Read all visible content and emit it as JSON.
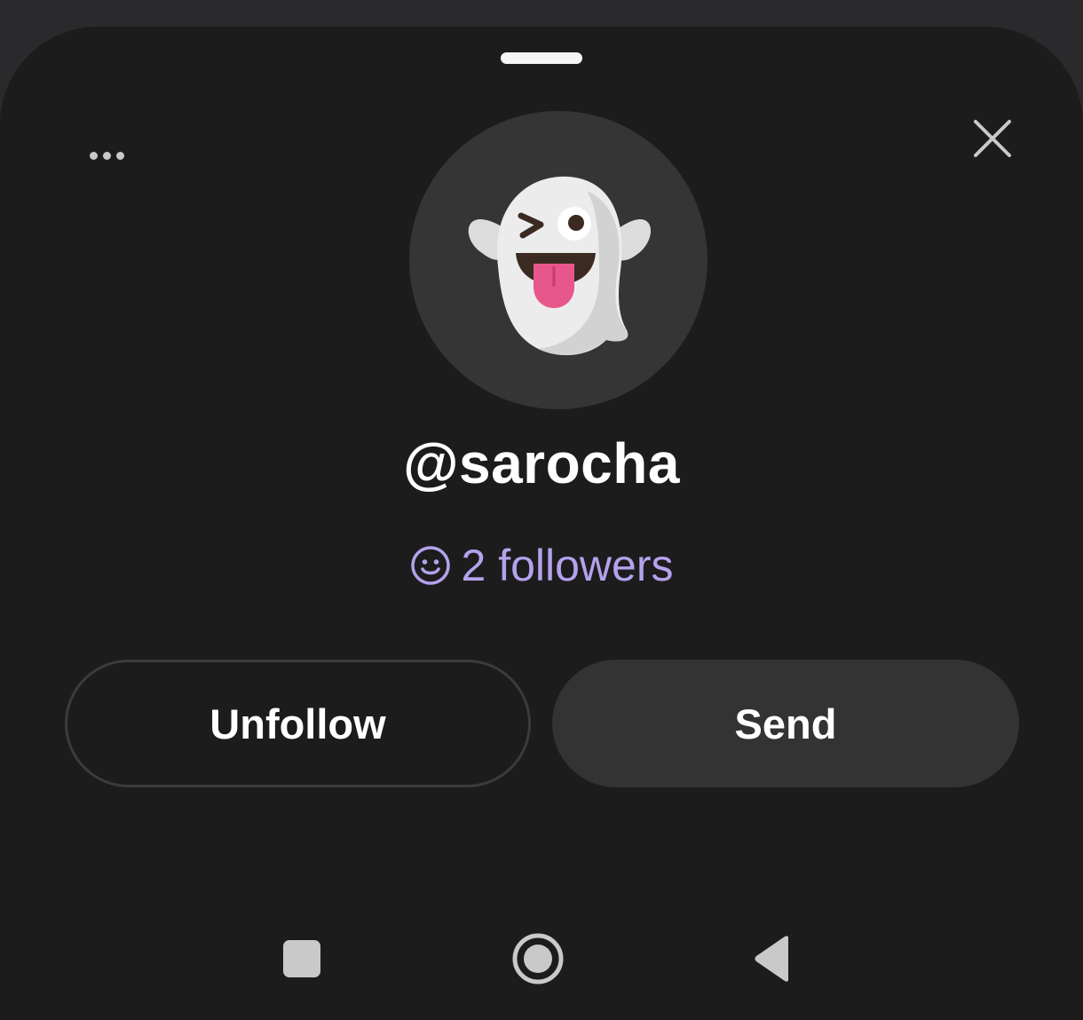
{
  "profile": {
    "username": "@sarocha",
    "followers_label": "2 followers",
    "avatar_icon": "winking-ghost-emoji-icon"
  },
  "actions": {
    "unfollow_label": "Unfollow",
    "send_label": "Send"
  },
  "header": {
    "more_icon": "more-horizontal-icon",
    "close_icon": "close-icon"
  },
  "navbar": {
    "recents_icon": "square-recents-icon",
    "home_icon": "circle-home-icon",
    "back_icon": "triangle-back-icon"
  },
  "colors": {
    "background": "#1c1c1d",
    "accent": "#b4a2ec",
    "button_fill": "#333334"
  }
}
